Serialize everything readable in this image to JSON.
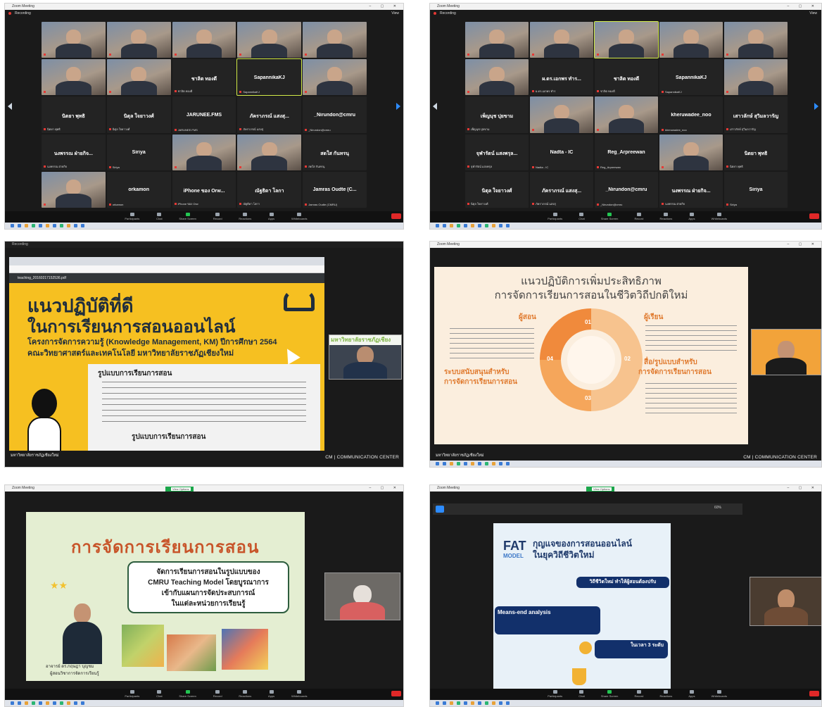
{
  "zoom": {
    "title": "Zoom Meeting",
    "recording": "Recording",
    "view": "View",
    "brand": "มหาวิทยาลัยราชภัฏเชียงใหม่",
    "cm_center": "CM | COMMUNICATION CENTER",
    "toolbar": [
      "Participants",
      "Chat",
      "Share Screen",
      "Record",
      "Reactions",
      "Apps",
      "Whiteboards"
    ],
    "view_options": "View Options"
  },
  "gallery1": {
    "tiles": [
      {
        "name": "",
        "label": "",
        "video": true
      },
      {
        "name": "",
        "label": "",
        "video": true
      },
      {
        "name": "",
        "label": "",
        "video": true
      },
      {
        "name": "",
        "label": "",
        "video": true
      },
      {
        "name": "",
        "label": "",
        "video": true
      },
      {
        "name": "",
        "label": "",
        "video": true
      },
      {
        "name": "",
        "label": "",
        "video": true
      },
      {
        "name": "ชาลิต ทองดี",
        "label": "ชาลิต ทองดี",
        "video": false
      },
      {
        "name": "SapannikaKJ",
        "label": "SapannikaKJ",
        "video": false,
        "active": true
      },
      {
        "name": "",
        "label": "",
        "video": true
      },
      {
        "name": "นิตยา พุทธิ",
        "label": "นิตยา พุทธิ",
        "video": false
      },
      {
        "name": "นิตุล ใจยาวงศ์",
        "label": "นิตุล ใจยาวงศ์",
        "video": false
      },
      {
        "name": "JARUNEE.FMS",
        "label": "JARUNEE.FMS",
        "video": false
      },
      {
        "name": "ภัคราภรณ์ แสงสุ...",
        "label": "ภัคราภรณ์ แสงสุ",
        "video": false
      },
      {
        "name": "_Nirundon@cmru",
        "label": "_Nirundon@cmru",
        "video": false
      },
      {
        "name": "นงพรรณ ฝ่ายกิจ...",
        "label": "นงพรรณ ฝ่ายกิจ",
        "video": false
      },
      {
        "name": "Siriya",
        "label": "Siriya",
        "video": false
      },
      {
        "name": "",
        "label": "",
        "video": true
      },
      {
        "name": "",
        "label": "",
        "video": true
      },
      {
        "name": "สดใส กันทรนุ",
        "label": "สดใส กันทรนุ",
        "video": false
      },
      {
        "name": "",
        "label": "",
        "video": true
      },
      {
        "name": "orkamon",
        "label": "orkamon",
        "video": false
      },
      {
        "name": "iPhone ของ Orw...",
        "label": "iPhone ของ Orw",
        "video": false
      },
      {
        "name": "ณัฐธิดา โลกา",
        "label": "ณัฐธิดา โลกา",
        "video": false
      },
      {
        "name": "Jamras Oudte (C...",
        "label": "Jamras Oudte (CMRU)",
        "video": false
      }
    ]
  },
  "gallery2": {
    "tiles": [
      {
        "name": "",
        "label": "",
        "video": true
      },
      {
        "name": "",
        "label": "",
        "video": true
      },
      {
        "name": "",
        "label": "",
        "video": true,
        "active": true
      },
      {
        "name": "",
        "label": "",
        "video": true
      },
      {
        "name": "",
        "label": "",
        "video": true
      },
      {
        "name": "",
        "label": "",
        "video": true
      },
      {
        "name": "ผ.ดร.เอกพร ทำร...",
        "label": "ผ.ดร.เอกพร ทำร",
        "video": false
      },
      {
        "name": "ชาลิต ทองดี",
        "label": "ชาลิต ทองดี",
        "video": false
      },
      {
        "name": "SapannikaKJ",
        "label": "SapannikaKJ",
        "video": false
      },
      {
        "name": "",
        "label": "",
        "video": true
      },
      {
        "name": "เพ็ญนุช ปุยขาม",
        "label": "เพ็ญนุช ปุยขาม",
        "video": false
      },
      {
        "name": "",
        "label": "",
        "video": true
      },
      {
        "name": "",
        "label": "",
        "video": true
      },
      {
        "name": "kheruwadee_noo",
        "label": "kheruwadee_noo",
        "video": false
      },
      {
        "name": "เสาวลักษ์ สุวิมลวารัญ",
        "label": "เสาวลักษ์ สุวิมลวารัญ",
        "video": false
      },
      {
        "name": "จุฬารัตน์ แสงพรุล...",
        "label": "จุฬารัตน์ แสงพรุล",
        "video": false
      },
      {
        "name": "Nadta - IC",
        "label": "Nadta - IC",
        "video": false
      },
      {
        "name": "Reg_Arpreewan",
        "label": "Reg_Arpreewan",
        "video": false
      },
      {
        "name": "",
        "label": "",
        "video": true
      },
      {
        "name": "นิตยา พุทธิ",
        "label": "นิตยา พุทธิ",
        "video": false
      },
      {
        "name": "นิตุล ใจยาวงศ์",
        "label": "นิตุล ใจยาวงศ์",
        "video": false
      },
      {
        "name": "ภัคราภรณ์ แสงสุ...",
        "label": "ภัคราภรณ์ แสงสุ",
        "video": false
      },
      {
        "name": "_Nirundon@cmru",
        "label": "_Nirundon@cmru",
        "video": false
      },
      {
        "name": "นงพรรณ ฝ่ายกิจ...",
        "label": "นงพรรณ ฝ่ายกิจ",
        "video": false
      },
      {
        "name": "Siriya",
        "label": "Siriya",
        "video": false
      }
    ]
  },
  "slide3": {
    "tab_file": "teaching_20160217152536.pdf",
    "title1": "แนวปฏิบัติที่ดี",
    "title2": "ในการเรียนการสอนออนไลน์",
    "project": "โครงการจัดการความรู้ (Knowledge Management, KM) ปีการศึกษา 2564",
    "faculty": "คณะวิทยาศาสตร์และเทคโนโลยี มหาวิทยาลัยราชภัฏเชียงใหม่",
    "box_title": "รูปแบบการเรียนการสอน",
    "box2_title": "รูปแบบการเรียนการสอน",
    "video_label": "มหาวิทยาลัยราชภัฏเชียง"
  },
  "slide4": {
    "title1": "แนวปฏิบัติการเพิ่มประสิทธิภาพ",
    "title2": "การจัดการเรียนการสอนในชีวิตวิถีปกติใหม่",
    "q1": "ผู้สอน",
    "q2": "ผู้เรียน",
    "q3": "สื่อ/รูปแบบสำหรับ",
    "q3b": "การจัดการเรียนการสอน",
    "q4": "ระบบสนับสนุนสำหรับ",
    "q4b": "การจัดการเรียนการสอน",
    "n1": "01",
    "n2": "02",
    "n3": "03",
    "n4": "04"
  },
  "slide5": {
    "title": "การจัดการเรียนการสอน",
    "sub1": "จัดการเรียนการสอนในรูปแบบของ",
    "sub2": "CMRU Teaching Model โดยบูรณาการ",
    "sub3": "เข้ากับแผนการจัดประสบการณ์",
    "sub4": "ในแต่ละหน่วยการเรียนรู้",
    "presenter": "อาจารย์ ดร.กฤษฎา บุญชม",
    "role": "ผู้สอนวิชาการจัดการเรียนรู้"
  },
  "slide6": {
    "fat": "FAT",
    "title1": "กุญแจของการสอนออนไลน์",
    "title2": "ในยุควิถีชีวิตใหม่",
    "model": "MODEL",
    "new_normal": "วิถีชีวิตใหม่ ทำให้ผู้สอนต้องปรับ",
    "means": "Means-end analysis",
    "levels": "ในเวลา 3 ระดับ",
    "zoom_pct": "60%"
  }
}
